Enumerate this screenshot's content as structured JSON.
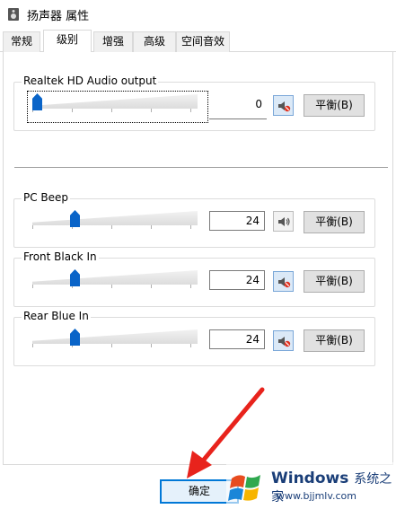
{
  "window": {
    "title": "扬声器 属性"
  },
  "tabs": [
    {
      "label": "常规"
    },
    {
      "label": "级别"
    },
    {
      "label": "增强"
    },
    {
      "label": "高级"
    },
    {
      "label": "空间音效"
    }
  ],
  "active_tab": "级别",
  "channels": [
    {
      "label": "Realtek HD Audio output",
      "value": "0",
      "level": 0,
      "muted": true,
      "balance_label": "平衡(B)"
    },
    {
      "label": "PC Beep",
      "value": "24",
      "level": 0.24,
      "muted": false,
      "balance_label": "平衡(B)"
    },
    {
      "label": "Front Black In",
      "value": "24",
      "level": 0.24,
      "muted": true,
      "balance_label": "平衡(B)"
    },
    {
      "label": "Rear Blue In",
      "value": "24",
      "level": 0.24,
      "muted": true,
      "balance_label": "平衡(B)"
    }
  ],
  "footer": {
    "ok_label": "确定"
  },
  "watermark": {
    "brand": "Windows",
    "suffix": "系统之家",
    "url": "www.bjjmlv.com"
  },
  "colors": {
    "accent": "#0078d7",
    "thumb": "#0a64c8",
    "annotation": "#e8231c"
  }
}
